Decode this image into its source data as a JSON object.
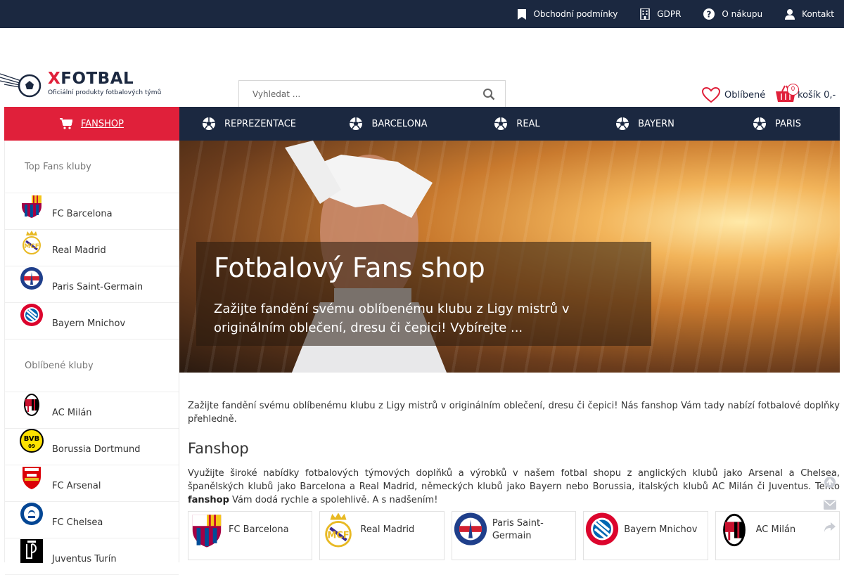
{
  "topbar": {
    "links": [
      {
        "label": "Obchodní podmínky",
        "icon": "bookmark-icon"
      },
      {
        "label": "GDPR",
        "icon": "building-icon"
      },
      {
        "label": "O nákupu",
        "icon": "question-icon"
      },
      {
        "label": "Kontakt",
        "icon": "user-icon"
      }
    ]
  },
  "logo": {
    "x": "X",
    "name": "FOTBAL",
    "tagline": "Oficiální produkty fotbalových týmů"
  },
  "search": {
    "placeholder": "Vyhledat ..."
  },
  "favorites": {
    "label": "Oblíbené"
  },
  "cart": {
    "count": "0",
    "label": "košík 0,-"
  },
  "nav": {
    "items": [
      {
        "label": "FANSHOP",
        "icon": "cart-icon"
      },
      {
        "label": "REPREZENTACE",
        "icon": "soccer-ball-icon"
      },
      {
        "label": "BARCELONA",
        "icon": "soccer-ball-icon"
      },
      {
        "label": "REAL",
        "icon": "soccer-ball-icon"
      },
      {
        "label": "BAYERN",
        "icon": "soccer-ball-icon"
      },
      {
        "label": "PARIS",
        "icon": "soccer-ball-icon"
      }
    ]
  },
  "sidebar": {
    "top_title": "Top Fans kluby",
    "top_clubs": [
      "FC Barcelona",
      "Real Madrid",
      "Paris Saint-Germain",
      "Bayern Mnichov"
    ],
    "fav_title": "Oblíbené kluby",
    "fav_clubs": [
      "AC Milán",
      "Borussia Dortmund",
      "FC Arsenal",
      "FC Chelsea",
      "Juventus Turín"
    ]
  },
  "hero": {
    "title": "Fotbalový Fans shop",
    "text": "Zažijte fandění svému oblíbenému klubu z Ligy mistrů v originálním oblečení, dresu či čepici! Vybírejte ..."
  },
  "content": {
    "intro": "Zažijte fandění svému oblíbenému klubu z Ligy mistrů v originálním oblečení, dresu či čepici! Nás fanshop Vám tady nabízí fotbalové doplňky přehledně.",
    "heading": "Fanshop",
    "para_before": "Využijte široké nabídky fotbalových týmových doplňků a výrobků v našem fotbal shopu z anglických klubů jako Arsenal a Chelsea, španělských klubů jako Barcelona a Real Madrid, německých klubů jako Bayern nebo Borussia, italských klubů AC Milán či Juventus. Tento ",
    "para_bold": "fanshop",
    "para_after": " Vám dodá rychle a spolehlivě. A s nadšením!"
  },
  "club_cards": [
    "FC Barcelona",
    "Real Madrid",
    "Paris Saint-Germain",
    "Bayern Mnichov",
    "AC Milán"
  ],
  "colors": {
    "navy": "#1b2840",
    "red": "#e0203a"
  }
}
